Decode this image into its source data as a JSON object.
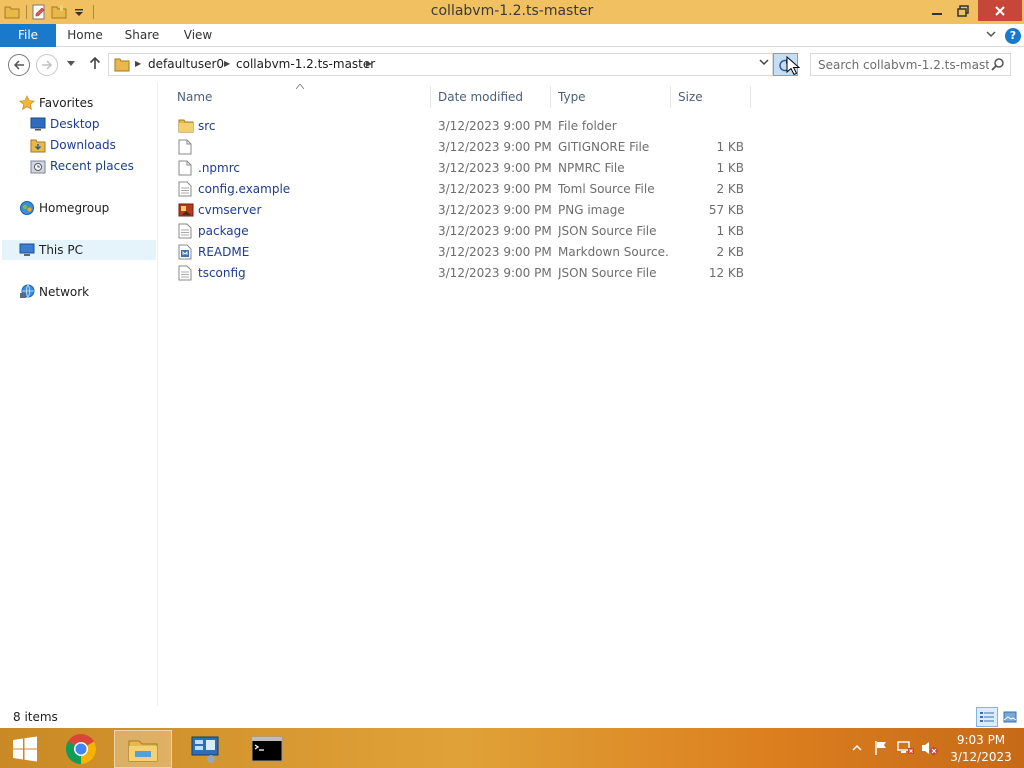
{
  "window": {
    "title": "collabvm-1.2.ts-master"
  },
  "ribbon": {
    "tabs": [
      {
        "label": "File"
      },
      {
        "label": "Home"
      },
      {
        "label": "Share"
      },
      {
        "label": "View"
      }
    ]
  },
  "address": {
    "breadcrumbs": [
      "defaultuser0",
      "collabvm-1.2.ts-master"
    ]
  },
  "search": {
    "placeholder": "Search collabvm-1.2.ts-master"
  },
  "navpane": {
    "favorites": "Favorites",
    "favorites_items": [
      "Desktop",
      "Downloads",
      "Recent places"
    ],
    "homegroup": "Homegroup",
    "this_pc": "This PC",
    "network": "Network"
  },
  "columns": {
    "name": "Name",
    "date": "Date modified",
    "type": "Type",
    "size": "Size"
  },
  "files": [
    {
      "name": "src",
      "date": "3/12/2023 9:00 PM",
      "type": "File folder",
      "size": "",
      "icon": "folder-icon"
    },
    {
      "name": "",
      "date": "3/12/2023 9:00 PM",
      "type": "GITIGNORE File",
      "size": "1 KB",
      "icon": "file-icon"
    },
    {
      "name": ".npmrc",
      "date": "3/12/2023 9:00 PM",
      "type": "NPMRC File",
      "size": "1 KB",
      "icon": "file-icon"
    },
    {
      "name": "config.example",
      "date": "3/12/2023 9:00 PM",
      "type": "Toml Source File",
      "size": "2 KB",
      "icon": "text-file-icon"
    },
    {
      "name": "cvmserver",
      "date": "3/12/2023 9:00 PM",
      "type": "PNG image",
      "size": "57 KB",
      "icon": "image-file-icon"
    },
    {
      "name": "package",
      "date": "3/12/2023 9:00 PM",
      "type": "JSON Source File",
      "size": "1 KB",
      "icon": "text-file-icon"
    },
    {
      "name": "README",
      "date": "3/12/2023 9:00 PM",
      "type": "Markdown Source...",
      "size": "2 KB",
      "icon": "markdown-file-icon"
    },
    {
      "name": "tsconfig",
      "date": "3/12/2023 9:00 PM",
      "type": "JSON Source File",
      "size": "12 KB",
      "icon": "text-file-icon"
    }
  ],
  "status": {
    "item_count": "8 items"
  },
  "taskbar": {
    "time": "9:03 PM",
    "date": "3/12/2023"
  },
  "colors": {
    "titlebar": "#f1c161",
    "file_tab": "#1979ca",
    "link_text": "#1c3c8e",
    "close_button": "#c7463a"
  }
}
